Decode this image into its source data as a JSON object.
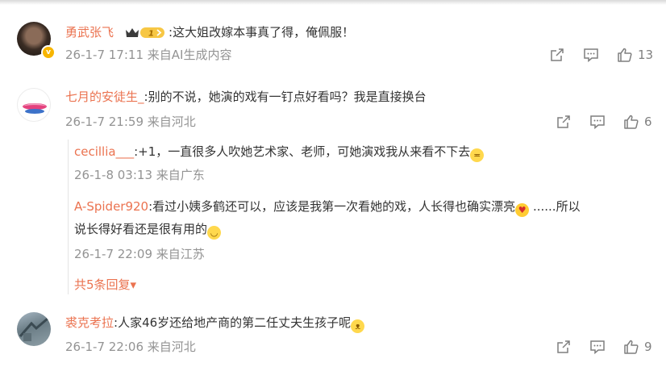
{
  "comments": [
    {
      "username": "勇武张飞",
      "separator": ":",
      "text": "这大姐改嫁本事真了得，俺佩服！",
      "meta": "26-1-7 17:11 来自AI生成内容",
      "like_count": "13",
      "badge_level": "1"
    },
    {
      "username": "七月的安徒生_",
      "separator": ":",
      "text": "别的不说，她演的戏有一钉点好看吗？我是直接换台",
      "meta": "26-1-7 21:59 来自河北",
      "like_count": "6"
    },
    {
      "username": "裘克考拉",
      "separator": ":",
      "text": "人家46岁还给地产商的第二任丈夫生孩子呢",
      "meta": "26-1-7 22:06 来自河北",
      "like_count": "9"
    }
  ],
  "replies": [
    {
      "username": "cecillia___",
      "separator": ":",
      "text": "+1，一直很多人吹她艺术家、老师，可她演戏我从来看不下去",
      "meta": "26-1-8 03:13 来自广东"
    },
    {
      "username": "A-Spider920",
      "separator": ":",
      "text": "看过小姨多鹤还可以，应该是我第一次看她的戏，人长得也确实漂亮",
      "text_tail": " ......所以",
      "line2": "说长得好看还是很有用的",
      "meta": "26-1-7 22:09 来自江苏"
    }
  ],
  "more_replies": "共5条回复▾",
  "colors": {
    "username": "#eb7350",
    "meta": "#939393",
    "text": "#333333",
    "divider": "#e4e4e4"
  },
  "icons": [
    "share-icon",
    "comment-icon",
    "like-icon",
    "crown-badge-icon",
    "emoji-icon"
  ]
}
